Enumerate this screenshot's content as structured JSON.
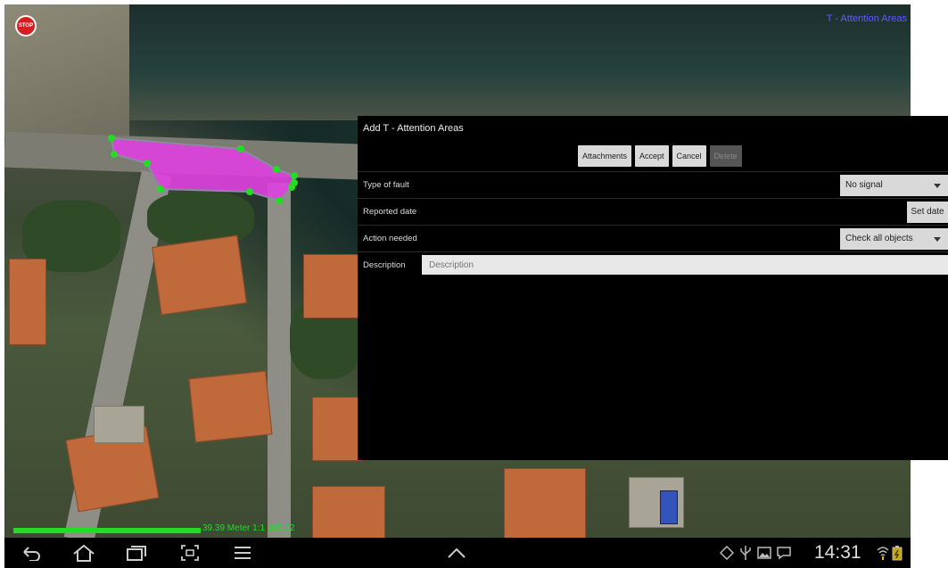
{
  "map": {
    "layer_title": "T - Attention Areas",
    "stop_label": "STOP",
    "scale_text": "39.39 Meter 1:1 398.32"
  },
  "dialog": {
    "title": "Add T - Attention Areas",
    "buttons": {
      "attachments": "Attachments",
      "accept": "Accept",
      "cancel": "Cancel",
      "delete": "Delete"
    },
    "fields": {
      "type_of_fault": {
        "label": "Type of fault",
        "value": "No signal"
      },
      "reported_date": {
        "label": "Reported date",
        "button": "Set date"
      },
      "action_needed": {
        "label": "Action needed",
        "value": "Check all objects"
      },
      "description": {
        "label": "Description",
        "placeholder": "Description",
        "value": ""
      }
    }
  },
  "statusbar": {
    "time": "14:31"
  },
  "colors": {
    "polygon_fill": "#e040e0",
    "vertex": "#22dd22",
    "scale": "#22dd22",
    "layer_title": "#5a5cff"
  },
  "icons": {
    "nav": [
      "back-icon",
      "home-icon",
      "recent-apps-icon",
      "screenshot-icon",
      "menu-icon",
      "up-arrow-icon"
    ],
    "status": [
      "gps-icon",
      "usb-icon",
      "gallery-icon",
      "notification-icon",
      "wifi-icon",
      "battery-icon"
    ]
  }
}
